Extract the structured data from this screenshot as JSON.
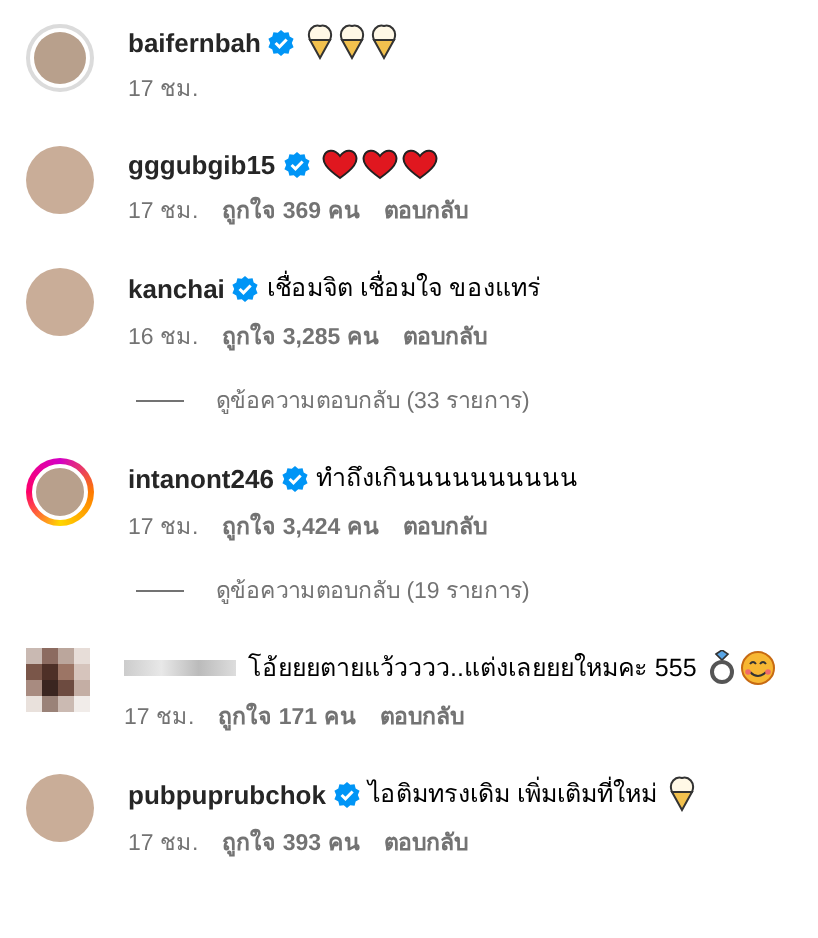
{
  "comments": [
    {
      "username": "baifernbah",
      "verified": true,
      "avatar": {
        "kind": "seen"
      },
      "emoji": [
        {
          "kind": "ice-cream"
        },
        {
          "kind": "ice-cream"
        },
        {
          "kind": "ice-cream"
        }
      ],
      "time": "17 ชม."
    },
    {
      "username": "gggubgib15",
      "verified": true,
      "avatar": {
        "kind": "plain"
      },
      "emoji": [
        {
          "kind": "heart"
        },
        {
          "kind": "heart"
        },
        {
          "kind": "heart"
        }
      ],
      "time": "17 ชม.",
      "likes": "ถูกใจ 369 คน",
      "reply": "ตอบกลับ"
    },
    {
      "username": "kanchai",
      "verified": true,
      "avatar": {
        "kind": "plain"
      },
      "text": "เชื่อมจิต เชื่อมใจ ของแทร่",
      "time": "16 ชม.",
      "likes": "ถูกใจ 3,285 คน",
      "reply": "ตอบกลับ",
      "view_replies": "ดูข้อความตอบกลับ (33 รายการ)"
    },
    {
      "username": "intanont246",
      "verified": true,
      "avatar": {
        "kind": "story"
      },
      "text": "ทำถึงเกินนนนนนนนนน",
      "time": "17 ชม.",
      "likes": "ถูกใจ 3,424 คน",
      "reply": "ตอบกลับ",
      "view_replies": "ดูข้อความตอบกลับ (19 รายการ)"
    },
    {
      "avatar": {
        "kind": "pixelated"
      },
      "text": "โอ้ยยยตายแว้วววว..แต่งเลยยยใหมคะ 555",
      "emoji": [
        {
          "kind": "ring"
        },
        {
          "kind": "smile"
        }
      ],
      "time": "17 ชม.",
      "likes": "ถูกใจ 171 คน",
      "reply": "ตอบกลับ"
    },
    {
      "username": "pubpuprubchok",
      "verified": true,
      "avatar": {
        "kind": "plain"
      },
      "text": "ไอติมทรงเดิม เพิ่มเติมที่ใหม่",
      "emoji": [
        {
          "kind": "ice-cream"
        }
      ],
      "time": "17 ชม.",
      "likes": "ถูกใจ 393 คน",
      "reply": "ตอบกลับ"
    }
  ]
}
